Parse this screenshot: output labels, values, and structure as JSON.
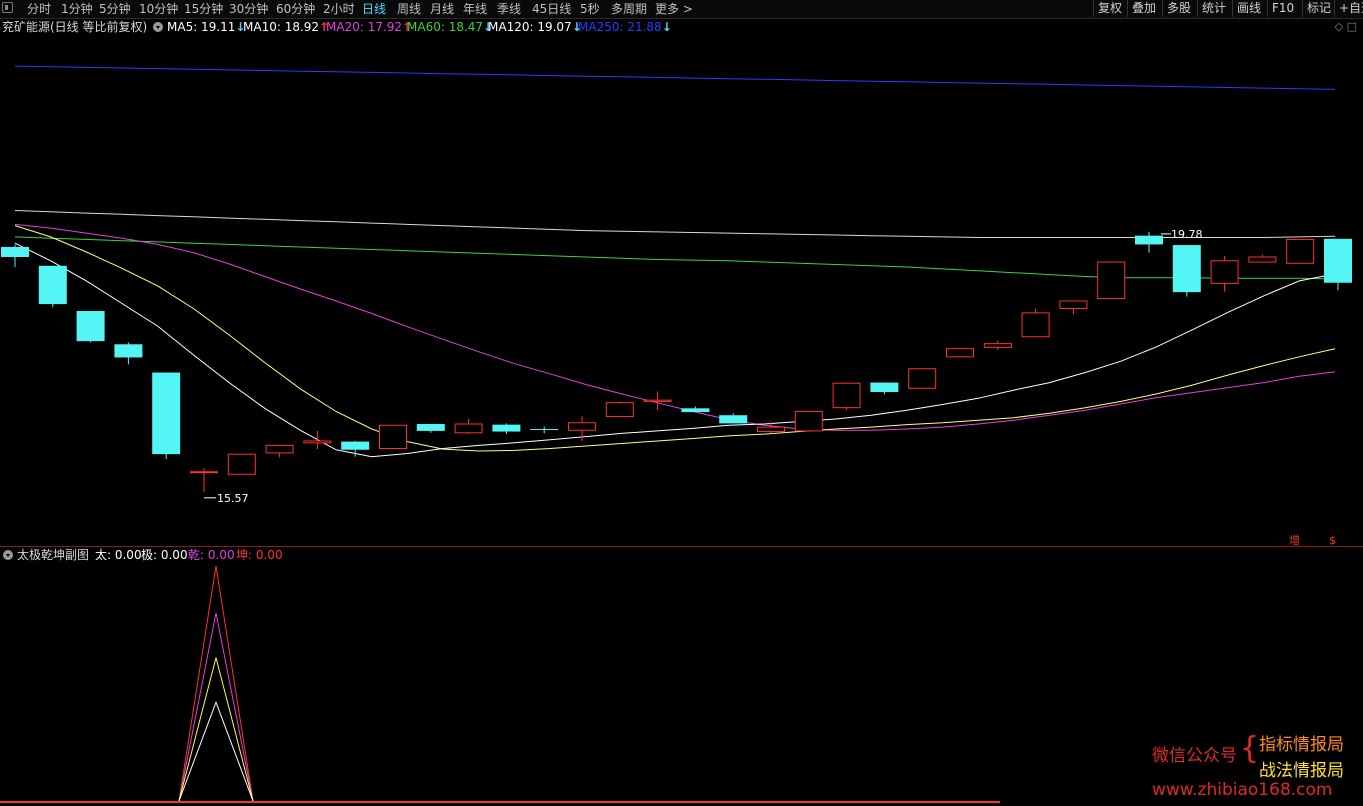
{
  "toolbar": {
    "periods": [
      "分时",
      "1分钟",
      "5分钟",
      "10分钟",
      "15分钟",
      "30分钟",
      "60分钟",
      "2小时",
      "日线",
      "周线",
      "月线",
      "年线",
      "季线",
      "45日线",
      "5秒",
      "多周期",
      "更多 >"
    ],
    "active_period": "日线",
    "right_buttons": [
      "复权",
      "叠加",
      "多股",
      "统计",
      "画线",
      "F10",
      "标记",
      "+自选"
    ]
  },
  "main_info": {
    "stock_title": "兖矿能源(日线 等比前复权)",
    "ma": [
      {
        "label": "MA5: 19.11",
        "arrow": "↓",
        "color": "#ffffff",
        "arrow_color": "#4fd6ff"
      },
      {
        "label": "MA10: 18.92",
        "arrow": "↑",
        "color": "#ffffff",
        "arrow_color": "#ff3030"
      },
      {
        "label": "MA20: 17.92",
        "arrow": "↑",
        "color": "#e040e0",
        "arrow_color": "#ff3030"
      },
      {
        "label": "MA60: 18.47",
        "arrow": "↓",
        "color": "#3ad43a",
        "arrow_color": "#4fd6ff"
      },
      {
        "label": "MA120: 19.07",
        "arrow": "↓",
        "color": "#ffffff",
        "arrow_color": "#4fd6ff"
      },
      {
        "label": "MA250: 21.88",
        "arrow": "↓",
        "color": "#2a3cff",
        "arrow_color": "#4fd6ff"
      }
    ],
    "right_icons": "◇ □"
  },
  "sub_info": {
    "title": "太极乾坤副图",
    "items": [
      {
        "label": "太: 0.00",
        "color": "#ffffff"
      },
      {
        "label": "极: 0.00",
        "color": "#ffffff"
      },
      {
        "label": "乾: 0.00",
        "color": "#e040e0"
      },
      {
        "label": "坤: 0.00",
        "color": "#ff3030"
      }
    ]
  },
  "chart_data": {
    "type": "candlestick",
    "y_range": [
      15.0,
      22.5
    ],
    "annotations": {
      "high_label": "19.78",
      "low_label": "15.57"
    },
    "corner_labels": [
      "增",
      "$"
    ],
    "candles": [
      {
        "o": 19.54,
        "h": 19.58,
        "l": 19.22,
        "c": 19.38
      },
      {
        "o": 19.24,
        "h": 19.24,
        "l": 18.58,
        "c": 18.63
      },
      {
        "o": 18.52,
        "h": 18.52,
        "l": 18.02,
        "c": 18.04
      },
      {
        "o": 17.99,
        "h": 18.02,
        "l": 17.67,
        "c": 17.78
      },
      {
        "o": 17.54,
        "h": 17.54,
        "l": 16.16,
        "c": 16.24
      },
      {
        "o": 15.95,
        "h": 16.02,
        "l": 15.64,
        "c": 15.96
      },
      {
        "o": 15.92,
        "h": 16.24,
        "l": 15.92,
        "c": 16.24
      },
      {
        "o": 16.26,
        "h": 16.38,
        "l": 16.19,
        "c": 16.38
      },
      {
        "o": 16.42,
        "h": 16.61,
        "l": 16.32,
        "c": 16.45
      },
      {
        "o": 16.44,
        "h": 16.45,
        "l": 16.2,
        "c": 16.31
      },
      {
        "o": 16.33,
        "h": 16.7,
        "l": 16.33,
        "c": 16.7
      },
      {
        "o": 16.72,
        "h": 16.72,
        "l": 16.58,
        "c": 16.61
      },
      {
        "o": 16.58,
        "h": 16.8,
        "l": 16.56,
        "c": 16.72
      },
      {
        "o": 16.71,
        "h": 16.73,
        "l": 16.56,
        "c": 16.6
      },
      {
        "o": 16.64,
        "h": 16.68,
        "l": 16.57,
        "c": 16.63
      },
      {
        "o": 16.62,
        "h": 16.85,
        "l": 16.45,
        "c": 16.74
      },
      {
        "o": 16.84,
        "h": 17.08,
        "l": 16.84,
        "c": 17.06
      },
      {
        "o": 17.08,
        "h": 17.24,
        "l": 16.94,
        "c": 17.1
      },
      {
        "o": 16.97,
        "h": 17.0,
        "l": 16.91,
        "c": 16.91
      },
      {
        "o": 16.86,
        "h": 16.89,
        "l": 16.73,
        "c": 16.73
      },
      {
        "o": 16.6,
        "h": 16.75,
        "l": 16.57,
        "c": 16.67
      },
      {
        "o": 16.61,
        "h": 16.92,
        "l": 16.61,
        "c": 16.92
      },
      {
        "o": 16.98,
        "h": 17.38,
        "l": 16.94,
        "c": 17.37
      },
      {
        "o": 17.38,
        "h": 17.38,
        "l": 17.19,
        "c": 17.23
      },
      {
        "o": 17.29,
        "h": 17.61,
        "l": 17.29,
        "c": 17.6
      },
      {
        "o": 17.79,
        "h": 17.92,
        "l": 17.79,
        "c": 17.92
      },
      {
        "o": 17.94,
        "h": 18.05,
        "l": 17.9,
        "c": 18.0
      },
      {
        "o": 18.11,
        "h": 18.56,
        "l": 18.11,
        "c": 18.49
      },
      {
        "o": 18.56,
        "h": 18.68,
        "l": 18.47,
        "c": 18.68
      },
      {
        "o": 18.72,
        "h": 19.31,
        "l": 18.72,
        "c": 19.3
      },
      {
        "o": 19.72,
        "h": 19.78,
        "l": 19.45,
        "c": 19.58
      },
      {
        "o": 19.57,
        "h": 19.57,
        "l": 18.75,
        "c": 18.82
      },
      {
        "o": 18.96,
        "h": 19.4,
        "l": 18.83,
        "c": 19.32
      },
      {
        "o": 19.3,
        "h": 19.42,
        "l": 19.3,
        "c": 19.38
      },
      {
        "o": 19.28,
        "h": 19.66,
        "l": 19.28,
        "c": 19.66
      },
      {
        "o": 19.67,
        "h": 19.67,
        "l": 18.85,
        "c": 18.97
      }
    ],
    "ma5": [
      19.6,
      19.32,
      19.0,
      18.64,
      18.28,
      17.82,
      17.38,
      16.97,
      16.62,
      16.31,
      16.2,
      16.25,
      16.33,
      16.38,
      16.42,
      16.47,
      16.52,
      16.57,
      16.61,
      16.65,
      16.7,
      16.72,
      16.76,
      16.8,
      16.86,
      16.94,
      17.03,
      17.13,
      17.26,
      17.38,
      17.54,
      17.72,
      17.95,
      18.22,
      18.5,
      18.76,
      19.0,
      19.11
    ],
    "ma10": [
      19.88,
      19.7,
      19.46,
      19.2,
      18.92,
      18.56,
      18.14,
      17.7,
      17.28,
      16.92,
      16.64,
      16.44,
      16.32,
      16.29,
      16.3,
      16.33,
      16.37,
      16.41,
      16.45,
      16.49,
      16.53,
      16.56,
      16.6,
      16.64,
      16.67,
      16.71,
      16.74,
      16.78,
      16.82,
      16.89,
      16.98,
      17.08,
      17.2,
      17.34,
      17.5,
      17.65,
      17.79,
      17.92
    ],
    "ma20": [
      19.9,
      19.84,
      19.76,
      19.68,
      19.58,
      19.45,
      19.27,
      19.07,
      18.87,
      18.68,
      18.48,
      18.27,
      18.07,
      17.87,
      17.68,
      17.52,
      17.35,
      17.2,
      17.06,
      16.92,
      16.79,
      16.7,
      16.64,
      16.62,
      16.62,
      16.64,
      16.67,
      16.72,
      16.78,
      16.86,
      16.94,
      17.04,
      17.14,
      17.22,
      17.3,
      17.38,
      17.48,
      17.55
    ],
    "ma60": [
      19.7,
      19.68,
      19.66,
      19.64,
      19.62,
      19.6,
      19.58,
      19.56,
      19.54,
      19.52,
      19.5,
      19.48,
      19.46,
      19.44,
      19.42,
      19.4,
      19.38,
      19.36,
      19.34,
      19.33,
      19.32,
      19.3,
      19.28,
      19.26,
      19.24,
      19.22,
      19.19,
      19.16,
      19.13,
      19.1,
      19.07,
      19.05,
      19.05,
      19.05,
      19.04,
      19.04,
      19.04,
      19.03
    ],
    "ma120": [
      20.12,
      20.1,
      20.08,
      20.06,
      20.04,
      20.02,
      20.0,
      19.98,
      19.96,
      19.94,
      19.92,
      19.9,
      19.88,
      19.86,
      19.84,
      19.82,
      19.8,
      19.79,
      19.78,
      19.77,
      19.76,
      19.75,
      19.74,
      19.73,
      19.72,
      19.71,
      19.7,
      19.69,
      19.69,
      19.69,
      19.69,
      19.69,
      19.69,
      19.69,
      19.69,
      19.69,
      19.7,
      19.71
    ],
    "ma250": [
      22.42,
      22.41,
      22.4,
      22.39,
      22.38,
      22.37,
      22.36,
      22.35,
      22.34,
      22.33,
      22.32,
      22.31,
      22.3,
      22.29,
      22.28,
      22.27,
      22.26,
      22.25,
      22.24,
      22.23,
      22.22,
      22.21,
      22.2,
      22.19,
      22.18,
      22.17,
      22.16,
      22.15,
      22.14,
      22.13,
      22.12,
      22.11,
      22.1,
      22.09,
      22.08,
      22.07,
      22.06,
      22.05
    ],
    "indicator": {
      "y_range": [
        0,
        100
      ],
      "peak_index": 5,
      "series": [
        {
          "name": "坤",
          "color": "#ff3030",
          "peak": 100
        },
        {
          "name": "乾",
          "color": "#e040e0",
          "peak": 80
        },
        {
          "name": "极",
          "color": "#ffff40",
          "peak": 61
        },
        {
          "name": "太",
          "color": "#ffffff",
          "peak": 42
        }
      ],
      "baseline_color": "#ff3030"
    }
  },
  "watermark": {
    "wechat": "微信公众号",
    "name1": "指标情报局",
    "name2": "战法情报局",
    "url": "www.zhibiao168.com"
  }
}
